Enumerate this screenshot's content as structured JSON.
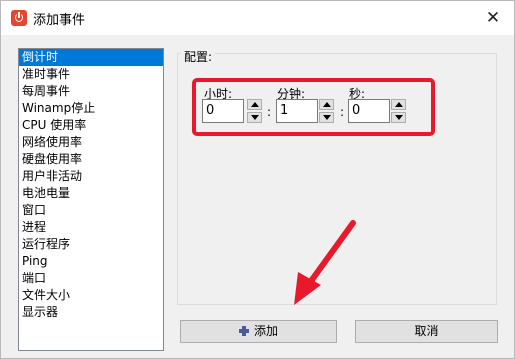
{
  "window": {
    "title": "添加事件",
    "close_symbol": "✕"
  },
  "event_list": {
    "items": [
      "倒计时",
      "准时事件",
      "每周事件",
      "Winamp停止",
      "CPU 使用率",
      "网络使用率",
      "硬盘使用率",
      "用户非活动",
      "电池电量",
      "窗口",
      "进程",
      "运行程序",
      "Ping",
      "端口",
      "文件大小",
      "显示器"
    ],
    "selected_index": 0
  },
  "config": {
    "group_label": "配置:",
    "hours": {
      "label": "小时:",
      "value": "0"
    },
    "minutes": {
      "label": "分钟:",
      "value": "1"
    },
    "seconds": {
      "label": "秒:",
      "value": "0"
    },
    "separator": ":"
  },
  "buttons": {
    "add_label": "添加",
    "cancel_label": "取消"
  },
  "colors": {
    "highlight": "#e8192b",
    "selection": "#0078d7",
    "arrow": "#e8192b",
    "app_icon": "#e8452e"
  },
  "icons": {
    "app": "app-alarm-icon",
    "add": "plus-icon",
    "close": "close-icon"
  }
}
